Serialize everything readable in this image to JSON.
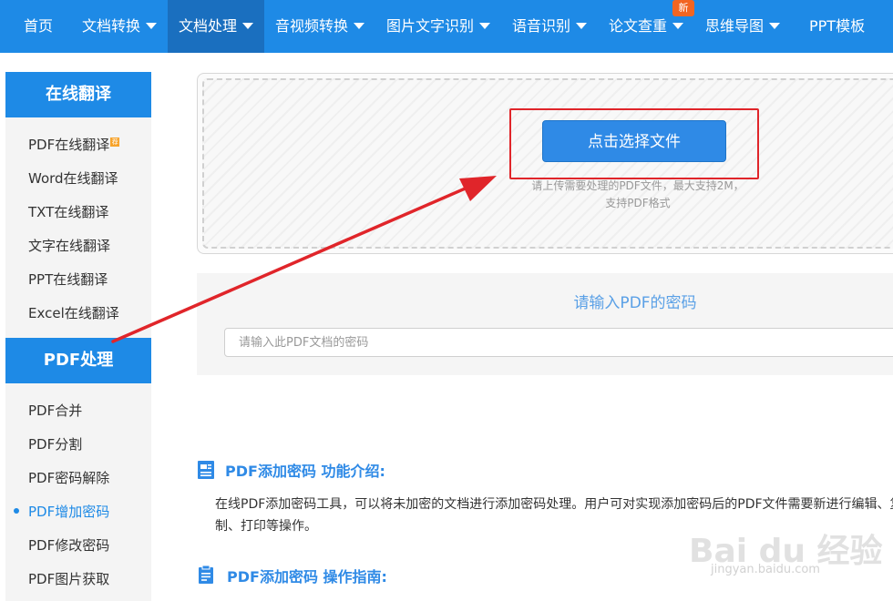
{
  "nav": {
    "items": [
      {
        "label": "首页",
        "dropdown": false
      },
      {
        "label": "文档转换",
        "dropdown": true
      },
      {
        "label": "文档处理",
        "dropdown": true,
        "active": true
      },
      {
        "label": "音视频转换",
        "dropdown": true
      },
      {
        "label": "图片文字识别",
        "dropdown": true
      },
      {
        "label": "语音识别",
        "dropdown": true
      },
      {
        "label": "论文查重",
        "dropdown": true
      },
      {
        "label": "思维导图",
        "dropdown": true
      },
      {
        "label": "PPT模板",
        "dropdown": false
      }
    ],
    "new_badge": "新"
  },
  "sidebar": {
    "sections": [
      {
        "title": "在线翻译",
        "items": [
          {
            "label": "PDF在线翻译",
            "tag": "荐"
          },
          {
            "label": "Word在线翻译"
          },
          {
            "label": "TXT在线翻译"
          },
          {
            "label": "文字在线翻译"
          },
          {
            "label": "PPT在线翻译"
          },
          {
            "label": "Excel在线翻译"
          }
        ]
      },
      {
        "title": "PDF处理",
        "items": [
          {
            "label": "PDF合并"
          },
          {
            "label": "PDF分割"
          },
          {
            "label": "PDF密码解除"
          },
          {
            "label": "PDF增加密码",
            "current": true
          },
          {
            "label": "PDF修改密码"
          },
          {
            "label": "PDF图片获取"
          }
        ]
      }
    ]
  },
  "upload": {
    "button_label": "点击选择文件",
    "hint_line1": "请上传需要处理的PDF文件，最大支持2M，",
    "hint_line2": "支持PDF格式"
  },
  "password": {
    "title": "请输入PDF的密码",
    "placeholder": "请输入此PDF文档的密码",
    "value": ""
  },
  "intro": {
    "feature_title": "PDF添加密码 功能介绍:",
    "feature_text": "在线PDF添加密码工具，可以将未加密的文档进行添加密码处理。用户可对实现添加密码后的PDF文件需要新进行编辑、复制、打印等操作。",
    "guide_title": "PDF添加密码 操作指南:"
  },
  "watermark": {
    "logo": "Bai du 经验",
    "url": "jingyan.baidu.com"
  },
  "colors": {
    "brand": "#1e8ae6",
    "annotation_red": "#e0252a",
    "badge_orange": "#f26522"
  }
}
